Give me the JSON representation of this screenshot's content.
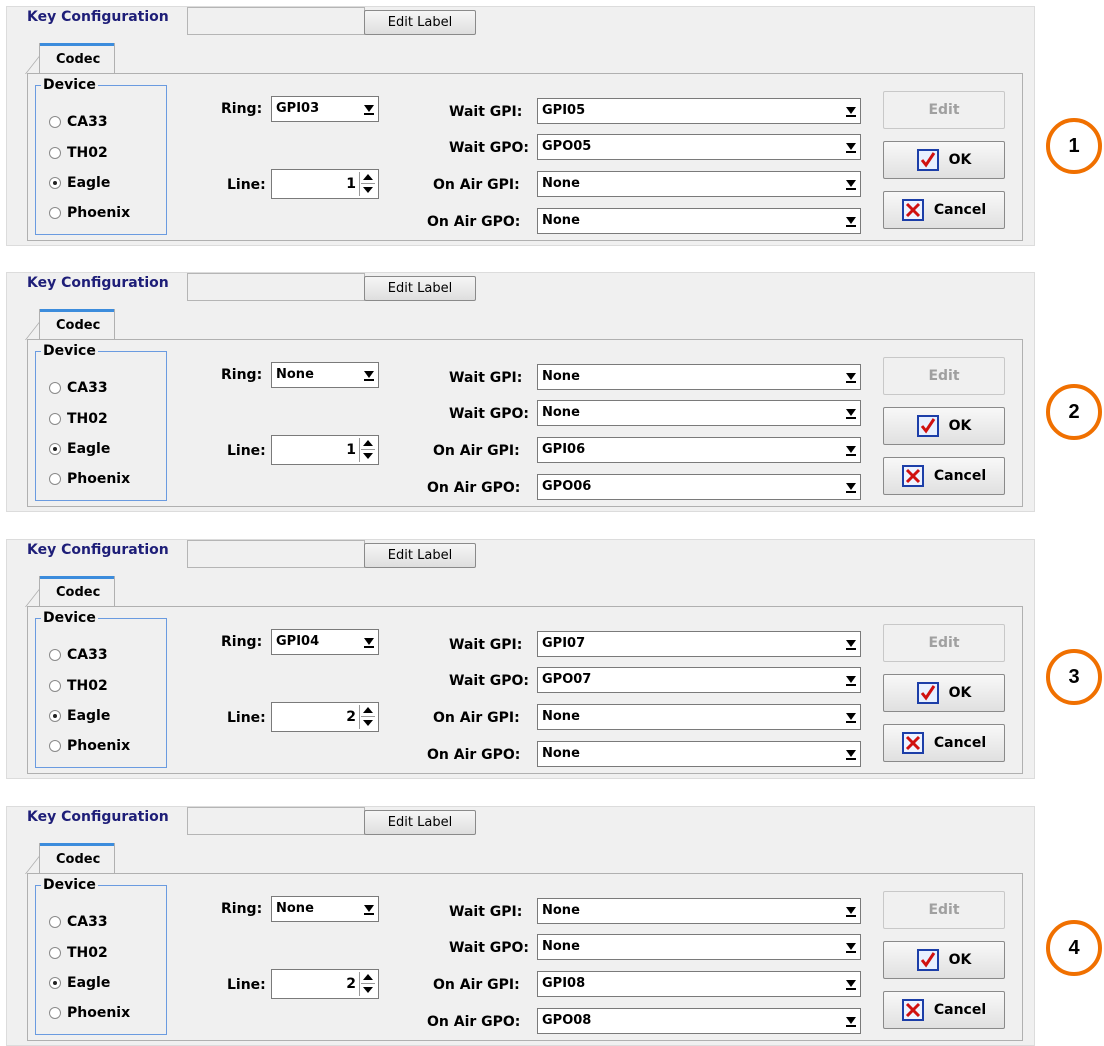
{
  "panels": [
    {
      "title": "Key Configuration",
      "edit_label": "Edit Label",
      "tab": "Codec",
      "device_title": "Device",
      "devices": [
        "CA33",
        "TH02",
        "Eagle",
        "Phoenix"
      ],
      "selected_device": "Eagle",
      "ring_label": "Ring:",
      "ring": "GPI03",
      "line_label": "Line:",
      "line": "1",
      "wait_gpi_label": "Wait GPI:",
      "wait_gpi": "GPI05",
      "wait_gpo_label": "Wait GPO:",
      "wait_gpo": "GPO05",
      "on_air_gpi_label": "On Air GPI:",
      "on_air_gpi": "None",
      "on_air_gpo_label": "On Air GPO:",
      "on_air_gpo": "None",
      "edit": "Edit",
      "ok": "OK",
      "cancel": "Cancel",
      "badge": "1"
    },
    {
      "title": "Key Configuration",
      "edit_label": "Edit Label",
      "tab": "Codec",
      "device_title": "Device",
      "devices": [
        "CA33",
        "TH02",
        "Eagle",
        "Phoenix"
      ],
      "selected_device": "Eagle",
      "ring_label": "Ring:",
      "ring": "None",
      "line_label": "Line:",
      "line": "1",
      "wait_gpi_label": "Wait GPI:",
      "wait_gpi": "None",
      "wait_gpo_label": "Wait GPO:",
      "wait_gpo": "None",
      "on_air_gpi_label": "On Air GPI:",
      "on_air_gpi": "GPI06",
      "on_air_gpo_label": "On Air GPO:",
      "on_air_gpo": "GPO06",
      "edit": "Edit",
      "ok": "OK",
      "cancel": "Cancel",
      "badge": "2"
    },
    {
      "title": "Key Configuration",
      "edit_label": "Edit Label",
      "tab": "Codec",
      "device_title": "Device",
      "devices": [
        "CA33",
        "TH02",
        "Eagle",
        "Phoenix"
      ],
      "selected_device": "Eagle",
      "ring_label": "Ring:",
      "ring": "GPI04",
      "line_label": "Line:",
      "line": "2",
      "wait_gpi_label": "Wait GPI:",
      "wait_gpi": "GPI07",
      "wait_gpo_label": "Wait GPO:",
      "wait_gpo": "GPO07",
      "on_air_gpi_label": "On Air GPI:",
      "on_air_gpi": "None",
      "on_air_gpo_label": "On Air GPO:",
      "on_air_gpo": "None",
      "edit": "Edit",
      "ok": "OK",
      "cancel": "Cancel",
      "badge": "3"
    },
    {
      "title": "Key Configuration",
      "edit_label": "Edit Label",
      "tab": "Codec",
      "device_title": "Device",
      "devices": [
        "CA33",
        "TH02",
        "Eagle",
        "Phoenix"
      ],
      "selected_device": "Eagle",
      "ring_label": "Ring:",
      "ring": "None",
      "line_label": "Line:",
      "line": "2",
      "wait_gpi_label": "Wait GPI:",
      "wait_gpi": "None",
      "wait_gpo_label": "Wait GPO:",
      "wait_gpo": "None",
      "on_air_gpi_label": "On Air GPI:",
      "on_air_gpi": "GPI08",
      "on_air_gpo_label": "On Air GPO:",
      "on_air_gpo": "GPO08",
      "edit": "Edit",
      "ok": "OK",
      "cancel": "Cancel",
      "badge": "4"
    }
  ],
  "colors": {
    "badge_ring": "#f07000",
    "title_text": "#1e1e78",
    "tab_accent": "#3c8cdc",
    "icon_check": "#d01010",
    "icon_frame": "#1c3ea8"
  },
  "icons": {
    "ok": "check-icon",
    "cancel": "x-icon"
  }
}
